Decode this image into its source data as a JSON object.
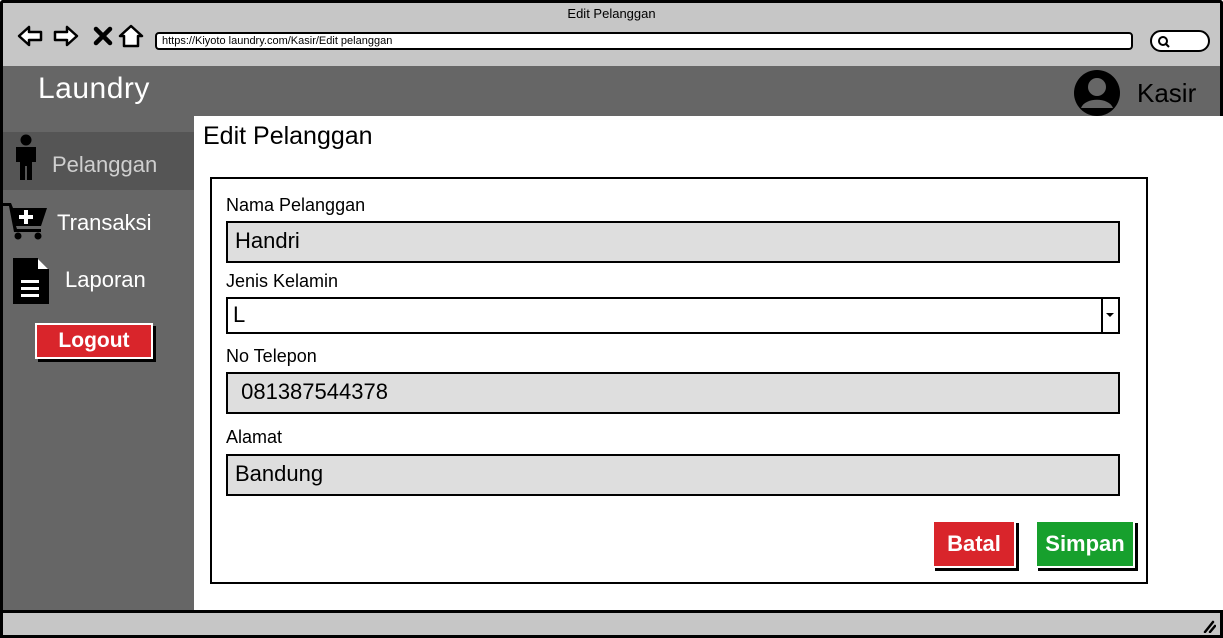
{
  "window": {
    "title": "Edit Pelanggan",
    "url": "https://Kiyoto laundry.com/Kasir/Edit pelanggan"
  },
  "header": {
    "brand": "Laundry",
    "user_name": "Kasir"
  },
  "sidebar": {
    "items": [
      {
        "label": "Pelanggan",
        "icon": "person-icon",
        "active": true
      },
      {
        "label": "Transaksi",
        "icon": "cart-add-icon",
        "active": false
      },
      {
        "label": "Laporan",
        "icon": "document-icon",
        "active": false
      }
    ],
    "logout_label": "Logout"
  },
  "main": {
    "title": "Edit Pelanggan",
    "form": {
      "nama_label": "Nama Pelanggan",
      "nama_value": "Handri",
      "jenis_label": "Jenis Kelamin",
      "jenis_value": "L",
      "telepon_label": "No Telepon",
      "telepon_value": " 081387544378",
      "alamat_label": "Alamat",
      "alamat_value": "Bandung"
    },
    "buttons": {
      "cancel": "Batal",
      "save": "Simpan"
    }
  },
  "colors": {
    "sidebar": "#666666",
    "danger": "#d9252b",
    "success": "#17a02d",
    "chrome": "#c6c6c6",
    "field": "#dedede"
  }
}
